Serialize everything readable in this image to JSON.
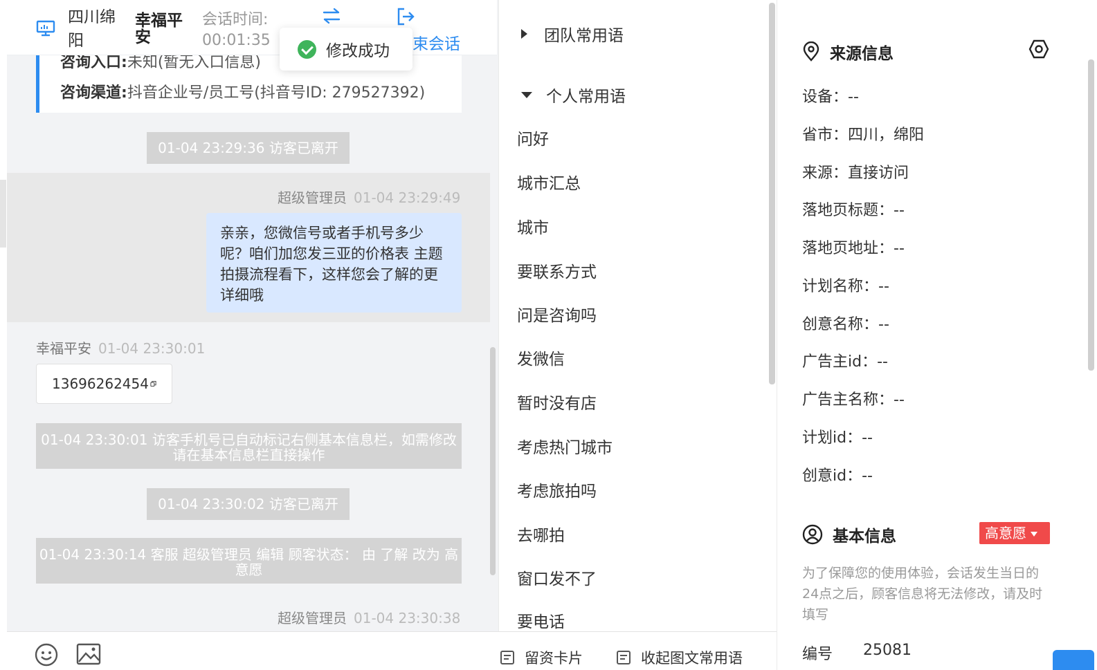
{
  "colors": {
    "accent": "#2d8cf0",
    "success": "#3fb45b",
    "badge": "#f04a4a",
    "agent_bubble": "#d9e8ff"
  },
  "header": {
    "location": "四川绵阳",
    "visitor_name": "幸福平安",
    "session_time_label": "会话时间:",
    "session_time": "00:01:35",
    "end_session_label": "束会话"
  },
  "toast": {
    "text": "修改成功",
    "icon": "check-circle-icon"
  },
  "info_card": {
    "entry_label": "咨询入口:",
    "entry_value": "未知(暂无入口信息)",
    "channel_label": "咨询渠道:",
    "channel_value": "抖音企业号/员工号(抖音号ID: 279527392)"
  },
  "messages": {
    "sys1": "01-04 23:29:36 访客已离开",
    "agent1_name": "超级管理员",
    "agent1_time": "01-04 23:29:49",
    "agent1_text": "亲亲，您微信号或者手机号多少呢？咱们加您发三亚的价格表 主题 拍摄流程看下，这样您会了解的更详细哦",
    "visitor1_name": "幸福平安",
    "visitor1_time": "01-04 23:30:01",
    "visitor1_text": "13696262454",
    "sys2": "01-04 23:30:01 访客手机号已自动标记右侧基本信息栏，如需修改请在基本信息栏直接操作",
    "sys3": "01-04 23:30:02 访客已离开",
    "sys4": "01-04 23:30:14 客服 超级管理员 编辑 顾客状态： 由 了解 改为 高意愿",
    "agent2_name": "超级管理员",
    "agent2_time": "01-04 23:30:38"
  },
  "phrases": {
    "team_group": "团队常用语",
    "personal_group": "个人常用语",
    "items": [
      "问好",
      "城市汇总",
      "城市",
      "要联系方式",
      "问是咨询吗",
      "发微信",
      "暂时没有店",
      "考虑热门城市",
      "考虑旅拍吗",
      "去哪拍",
      "窗口发不了",
      "要电话"
    ],
    "footer_card": "留资卡片",
    "footer_collapse": "收起图文常用语"
  },
  "source_info": {
    "title": "来源信息",
    "fields": [
      "设备：--",
      "省市：四川，绵阳",
      "来源：直接访问",
      "落地页标题：--",
      "落地页地址：--",
      "计划名称：--",
      "创意名称：--",
      "广告主id：--",
      "广告主名称：--",
      "计划id：--",
      "创意id：--"
    ]
  },
  "basic_info": {
    "title": "基本信息",
    "status_badge": "高意愿",
    "note": "为了保障您的使用体验，会话发生当日的24点之后，顾客信息将无法修改，请及时填写",
    "id_label": "编号",
    "id_value": "25081"
  }
}
